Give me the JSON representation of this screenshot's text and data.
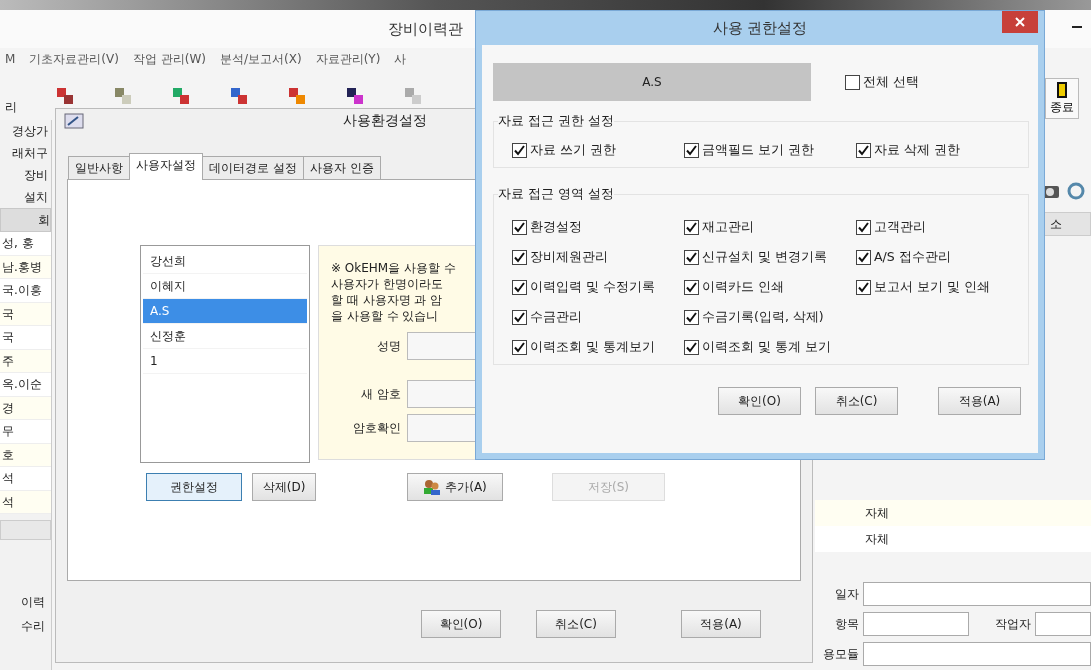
{
  "main_window": {
    "title": "장비이력관",
    "menu": [
      "M",
      "기초자료관리(V)",
      "작업 관리(W)",
      "분석/보고서(X)",
      "자료관리(Y)",
      "사"
    ],
    "toolbar_label": "리",
    "exit_button": "종료",
    "left_labels": [
      "경상가",
      "래처구",
      "장비",
      "설치"
    ],
    "left_header": "회",
    "left_rows": [
      "성, 홍",
      "남.홍병",
      "국.이흥",
      "국",
      "국",
      "주",
      "옥.이순",
      "경",
      "무",
      "호",
      "석",
      "석"
    ],
    "left_bottom": [
      "이력",
      "수리"
    ],
    "right_header": "소",
    "right_rows": [
      "자체",
      "자체"
    ],
    "form": {
      "date_label": "일자",
      "item_label": "항목",
      "worker_label": "작업자",
      "module_label": "용모듈"
    }
  },
  "settings_dialog": {
    "title": "사용환경설정",
    "tabs": [
      {
        "label": "일반사항",
        "selected": false
      },
      {
        "label": "사용자설정",
        "selected": true
      },
      {
        "label": "데이터경로 설정",
        "selected": false
      },
      {
        "label": "사용자 인증",
        "selected": false
      }
    ],
    "users": [
      {
        "name": "강선희",
        "selected": false
      },
      {
        "name": "이혜지",
        "selected": false
      },
      {
        "name": "A.S",
        "selected": true
      },
      {
        "name": "신정훈",
        "selected": false
      },
      {
        "name": "1",
        "selected": false
      }
    ],
    "list_buttons": [
      "권한설정",
      "삭제(D)"
    ],
    "note": [
      "※ OkEHM을 사용할 수",
      "사용자가 한명이라도",
      "할 때 사용자명 과 암",
      "을 사용할 수 있습니"
    ],
    "fields": [
      {
        "label": "성명"
      },
      {
        "label": "새 암호"
      },
      {
        "label": "암호확인"
      }
    ],
    "add_button": "추가(A)",
    "save_button": {
      "label": "저장(S)",
      "disabled": true
    },
    "buttons": [
      "확인(O)",
      "취소(C)",
      "적용(A)"
    ]
  },
  "permission_dialog": {
    "title": "사용 권한설정",
    "user": "A.S",
    "select_all": {
      "label": "전체 선택",
      "checked": false
    },
    "groups": [
      {
        "title": "자료 접근 권한 설정",
        "rows": [
          [
            {
              "label": "자료 쓰기 권한",
              "checked": true
            },
            {
              "label": "금액필드 보기 권한",
              "checked": true
            },
            {
              "label": "자료 삭제 권한",
              "checked": true
            }
          ]
        ]
      },
      {
        "title": "자료 접근 영역 설정",
        "rows": [
          [
            {
              "label": "환경설정",
              "checked": true
            },
            {
              "label": "재고관리",
              "checked": true
            },
            {
              "label": "고객관리",
              "checked": true
            }
          ],
          [
            {
              "label": "장비제원관리",
              "checked": true
            },
            {
              "label": "신규설치 및 변경기록",
              "checked": true
            },
            {
              "label": "A/S 접수관리",
              "checked": true
            }
          ],
          [
            {
              "label": "이력입력 및 수정기록",
              "checked": true
            },
            {
              "label": "이력카드 인쇄",
              "checked": true
            },
            {
              "label": "보고서 보기 및 인쇄",
              "checked": true
            }
          ],
          [
            {
              "label": "수금관리",
              "checked": true
            },
            {
              "label": "수금기록(입력, 삭제)",
              "checked": true
            }
          ],
          [
            {
              "label": "이력조회 및 통계보기",
              "checked": true
            },
            {
              "label": "이력조회 및 통계 보기",
              "checked": true
            }
          ]
        ]
      }
    ],
    "buttons": [
      "확인(O)",
      "취소(C)",
      "적용(A)"
    ]
  }
}
